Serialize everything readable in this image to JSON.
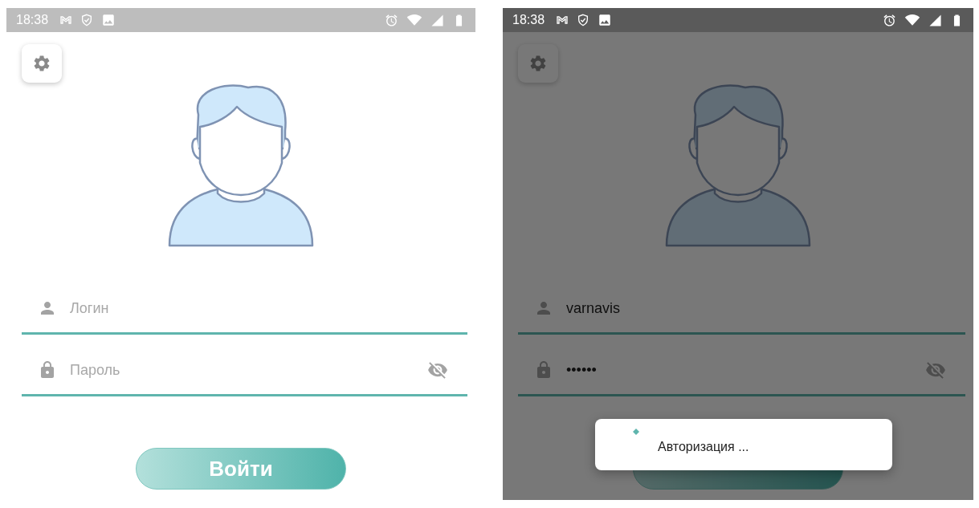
{
  "screens": [
    {
      "status_bar": {
        "time": "18:38"
      },
      "login": {
        "placeholder": "Логин"
      },
      "password": {
        "placeholder": "Пароль"
      },
      "button": {
        "label": "Войти"
      }
    },
    {
      "status_bar": {
        "time": "18:38"
      },
      "login": {
        "value": "varnavis"
      },
      "password": {
        "value": "••••••"
      },
      "dialog": {
        "message": "Авторизация ..."
      }
    }
  ]
}
